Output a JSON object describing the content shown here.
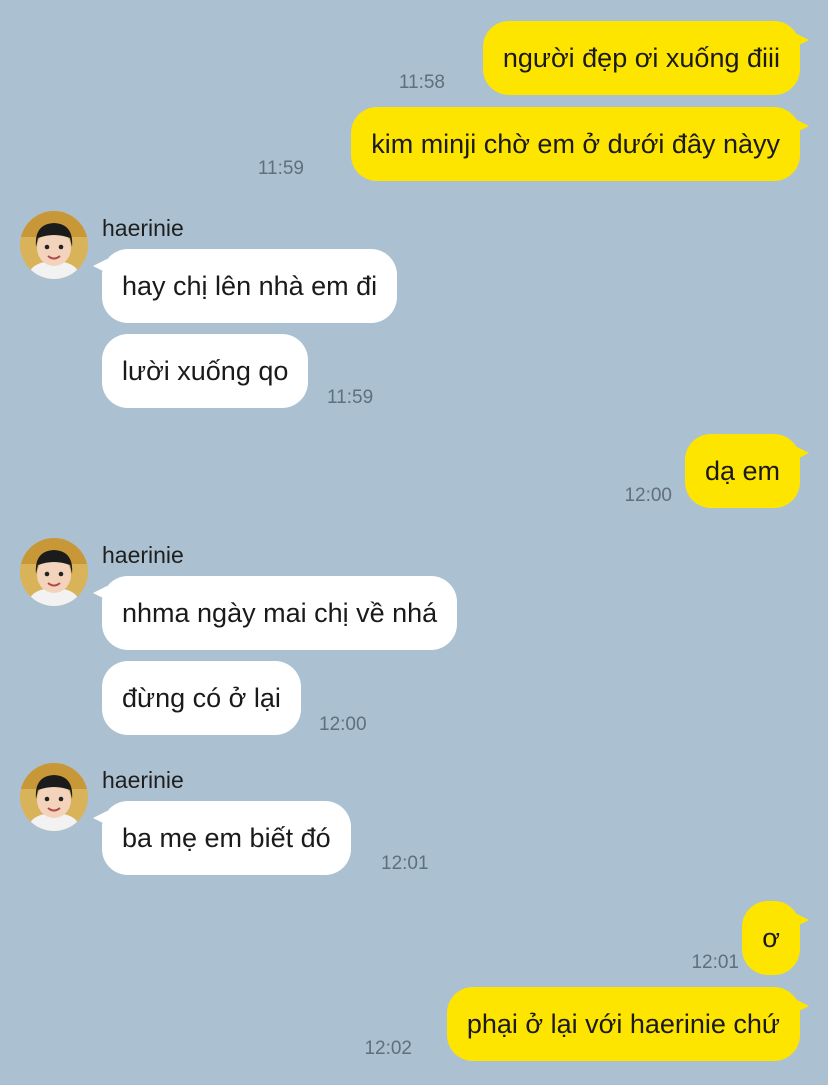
{
  "contact": {
    "name": "haerinie"
  },
  "colors": {
    "background": "#abc1d1",
    "outgoing_bubble": "#fee500",
    "incoming_bubble": "#ffffff",
    "timestamp": "#5f6f7c"
  },
  "icons": {
    "avatar": "profile-photo-avatar"
  },
  "messages": [
    {
      "direction": "out",
      "text": "người đẹp ơi xuống điii",
      "time": "11:58"
    },
    {
      "direction": "out",
      "text": "kim minji chờ em ở dưới đây nàyy",
      "time": "11:59"
    },
    {
      "direction": "in",
      "sender": "haerinie",
      "text": "hay chị lên nhà em đi"
    },
    {
      "direction": "in",
      "text": "lười xuống qo",
      "time": "11:59"
    },
    {
      "direction": "out",
      "text": "dạ em",
      "time": "12:00"
    },
    {
      "direction": "in",
      "sender": "haerinie",
      "text": "nhma ngày mai chị về nhá"
    },
    {
      "direction": "in",
      "text": "đừng có ở lại",
      "time": "12:00"
    },
    {
      "direction": "in",
      "sender": "haerinie",
      "text": "ba mẹ em biết đó",
      "time": "12:01"
    },
    {
      "direction": "out",
      "text": "ơ",
      "time": "12:01"
    },
    {
      "direction": "out",
      "text": "phại ở lại với haerinie chứ",
      "time": "12:02"
    }
  ]
}
